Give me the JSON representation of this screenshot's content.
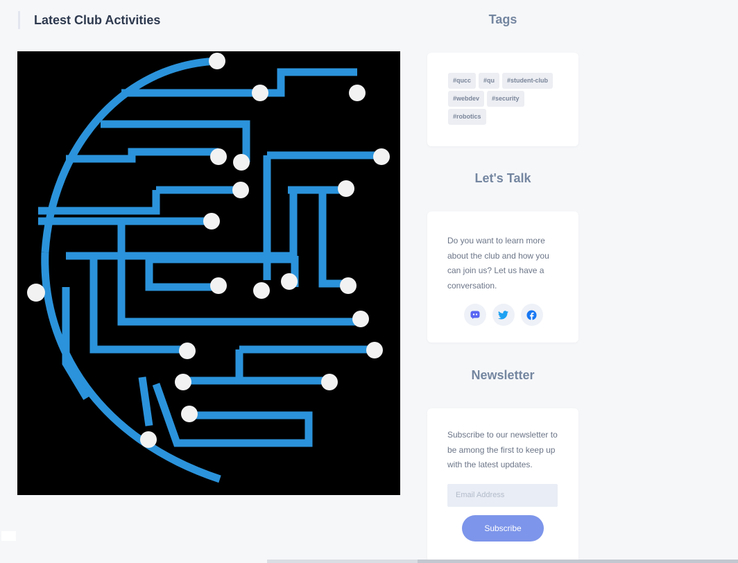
{
  "main": {
    "section_title": "Latest Club Activities",
    "featured_image_icon": "circuit-globe-graphic",
    "colors": {
      "circuit": "#2b93db",
      "node": "#f2f2f2",
      "background": "#000000"
    }
  },
  "sidebar": {
    "tags_heading": "Tags",
    "tags": [
      "#qucc",
      "#qu",
      "#student-club",
      "#webdev",
      "#security",
      "#robotics"
    ],
    "talk_heading": "Let's Talk",
    "talk_text": "Do you want to learn more about the club and how you can join us? Let us have a conversation.",
    "socials": [
      {
        "icon": "discord-icon",
        "color": "#5865f2"
      },
      {
        "icon": "twitter-icon",
        "color": "#1da1f2"
      },
      {
        "icon": "facebook-icon",
        "color": "#1877f2"
      }
    ],
    "newsletter_heading": "Newsletter",
    "newsletter_text": "Subscribe to our newsletter to be among the first to keep up with the latest updates.",
    "email_placeholder": "Email Address",
    "subscribe_label": "Subscribe",
    "accent_color": "#7d95ea"
  }
}
